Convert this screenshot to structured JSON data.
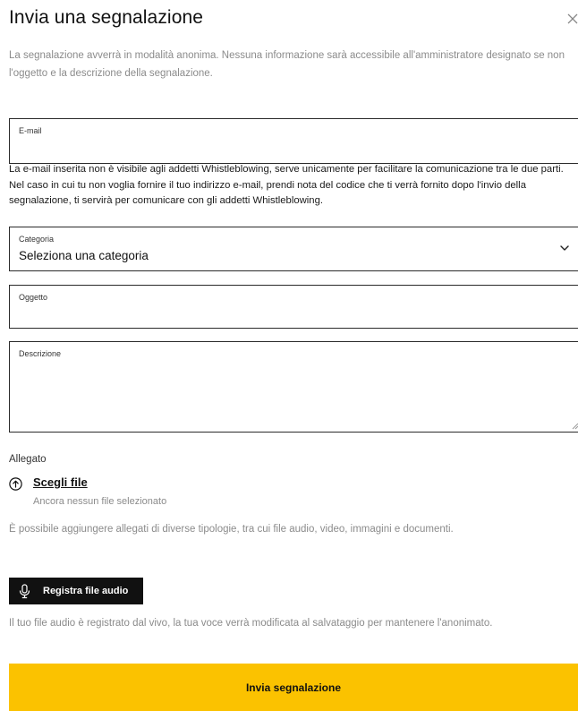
{
  "dialog": {
    "title": "Invia una segnalazione",
    "close_icon": "close-icon",
    "intro": "La segnalazione avverrà in modalità anonima. Nessuna informazione sarà accessibile all'amministratore designato se non l'oggetto e la descrizione della segnalazione."
  },
  "email": {
    "label": "E-mail",
    "value": "",
    "note": "La e-mail inserita non è visibile agli addetti Whistleblowing, serve unicamente per facilitare la comunicazione tra le due parti. Nel caso in cui tu non voglia fornire il tuo indirizzo e-mail, prendi nota del codice che ti verrà fornito dopo l'invio della segnalazione, ti servirà per comunicare con gli addetti Whistleblowing."
  },
  "category": {
    "label": "Categoria",
    "selected": "Seleziona una categoria",
    "icon": "chevron-down-icon"
  },
  "subject": {
    "label": "Oggetto",
    "value": ""
  },
  "description": {
    "label": "Descrizione",
    "value": ""
  },
  "attachment": {
    "label": "Allegato",
    "choose_label": "Scegli file",
    "status": "Ancora nessun file selezionato",
    "info": "È possibile aggiungere allegati di diverse tipologie, tra cui file audio, video, immagini e documenti.",
    "icon": "upload-icon"
  },
  "audio": {
    "button_label": "Registra file audio",
    "icon": "microphone-icon",
    "info": "Il tuo file audio è registrato dal vivo, la tua voce verrà modificata al salvataggio per mantenere l'anonimato."
  },
  "submit": {
    "label": "Invia segnalazione"
  },
  "colors": {
    "accent": "#fbc200",
    "dark_button": "#111111",
    "muted_text": "#8b8b8b",
    "field_border": "#2a2a2a"
  }
}
